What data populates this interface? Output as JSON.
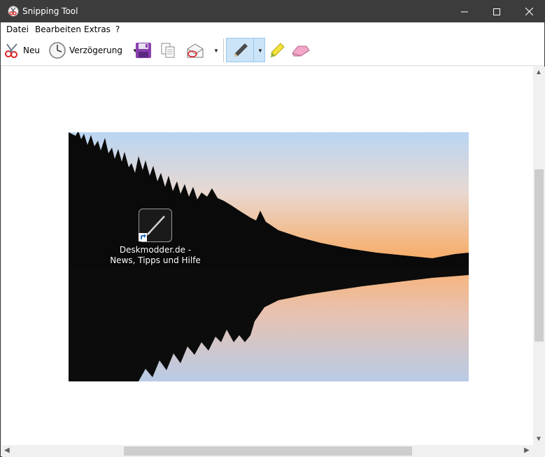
{
  "window": {
    "title": "Snipping Tool",
    "controls": [
      "minimize",
      "maximize",
      "close"
    ]
  },
  "menu": {
    "items": [
      "Datei",
      "Bearbeiten",
      "Extras",
      "?"
    ]
  },
  "toolbar": {
    "new_label": "Neu",
    "delay_label": "Verzögerung",
    "icons": [
      "scissors-icon",
      "clock-icon",
      "save-icon",
      "copy-icon",
      "send-email-icon",
      "pen-icon",
      "highlighter-icon",
      "eraser-icon"
    ],
    "active_tool": "pen"
  },
  "capture": {
    "shortcut_label_line1": "Deskmodder.de -",
    "shortcut_label_line2": "News, Tipps und Hilfe"
  },
  "colors": {
    "titlebar": "#3c3c3c",
    "active_tool_bg": "#cce4f7",
    "active_tool_border": "#99c9ef"
  }
}
